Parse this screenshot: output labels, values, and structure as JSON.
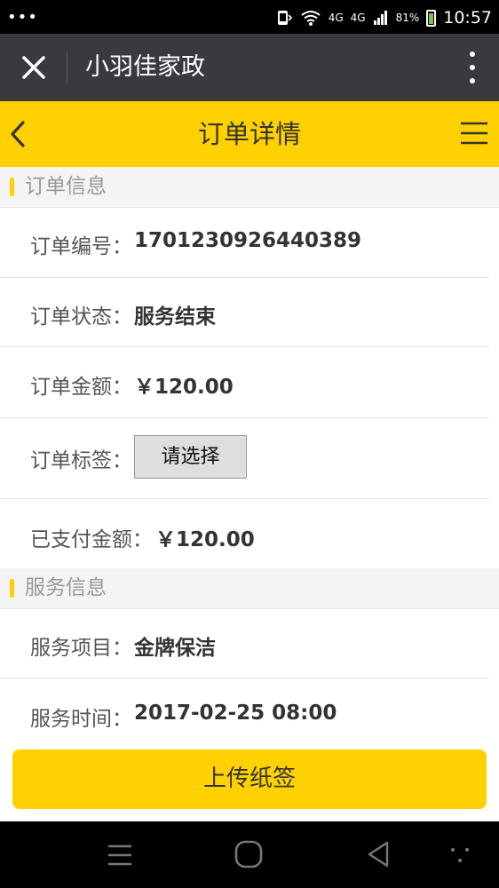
{
  "status_bar": {
    "dots": "•••",
    "network_1": "4G",
    "network_2": "4G",
    "battery_percent": "81%",
    "time": "10:57"
  },
  "app_bar": {
    "title": "小羽佳家政"
  },
  "header": {
    "title": "订单详情"
  },
  "order_section": {
    "title": "订单信息",
    "rows": [
      {
        "label": "订单编号：",
        "value": "1701230926440389"
      },
      {
        "label": "订单状态：",
        "value": "服务结束"
      },
      {
        "label": "订单金额：",
        "value": "￥120.00"
      },
      {
        "label": "订单标签：",
        "value": "请选择"
      },
      {
        "label": "已支付金额：",
        "value": "￥120.00"
      }
    ]
  },
  "service_section": {
    "title": "服务信息",
    "rows": [
      {
        "label": "服务项目：",
        "value": "金牌保洁"
      },
      {
        "label": "服务时间：",
        "value": "2017-02-25 08:00"
      }
    ]
  },
  "upload_button": "上传纸签",
  "colors": {
    "accent": "#ffd100",
    "price": "#cc1166",
    "app_bar": "#393a3f"
  }
}
